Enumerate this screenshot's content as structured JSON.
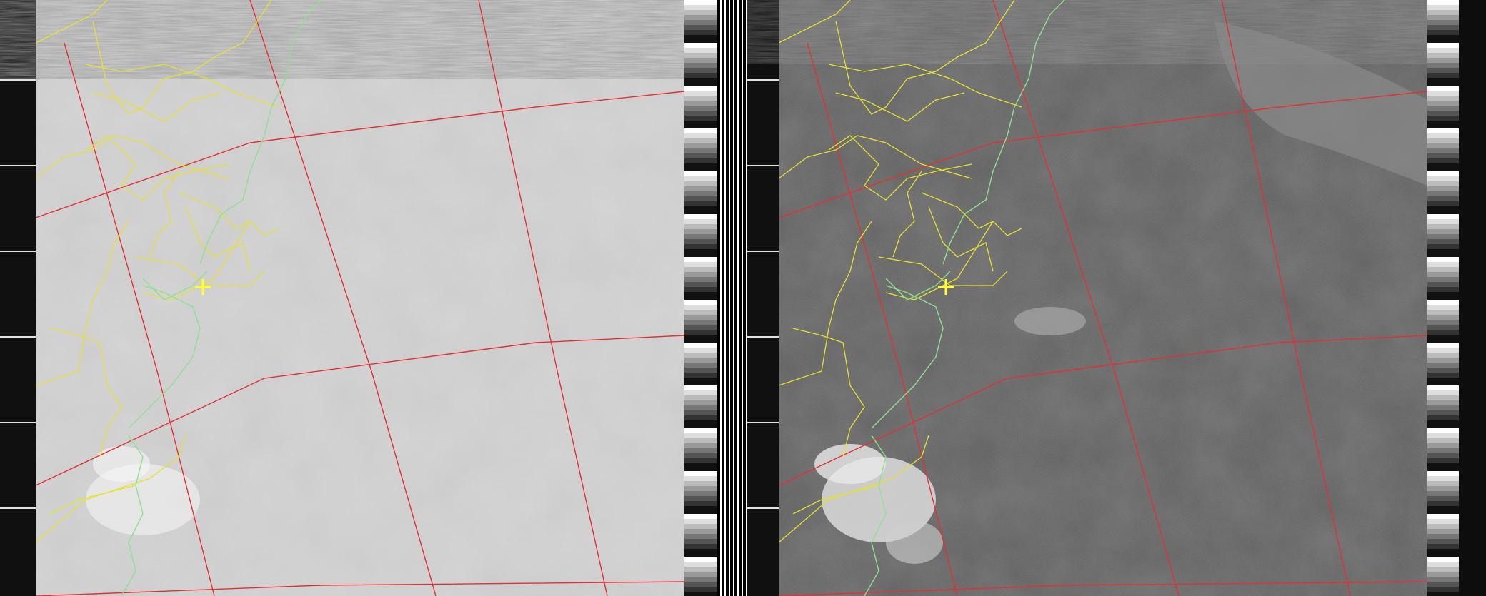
{
  "image": {
    "kind": "weather-satellite-image",
    "channels": [
      {
        "name": "visible",
        "tone": "light",
        "base_color": "#cfcfcf",
        "cloud_color": "#f2f2f2"
      },
      {
        "name": "infrared",
        "tone": "dark",
        "base_color": "#5a5a5a",
        "cloud_color": "#e6e6e6"
      }
    ],
    "overlays": {
      "graticule_color": "#e53030",
      "boundary_color": "#e8e030",
      "coastline_color": "#8fe08f",
      "marker_color": "#ffff33"
    }
  }
}
